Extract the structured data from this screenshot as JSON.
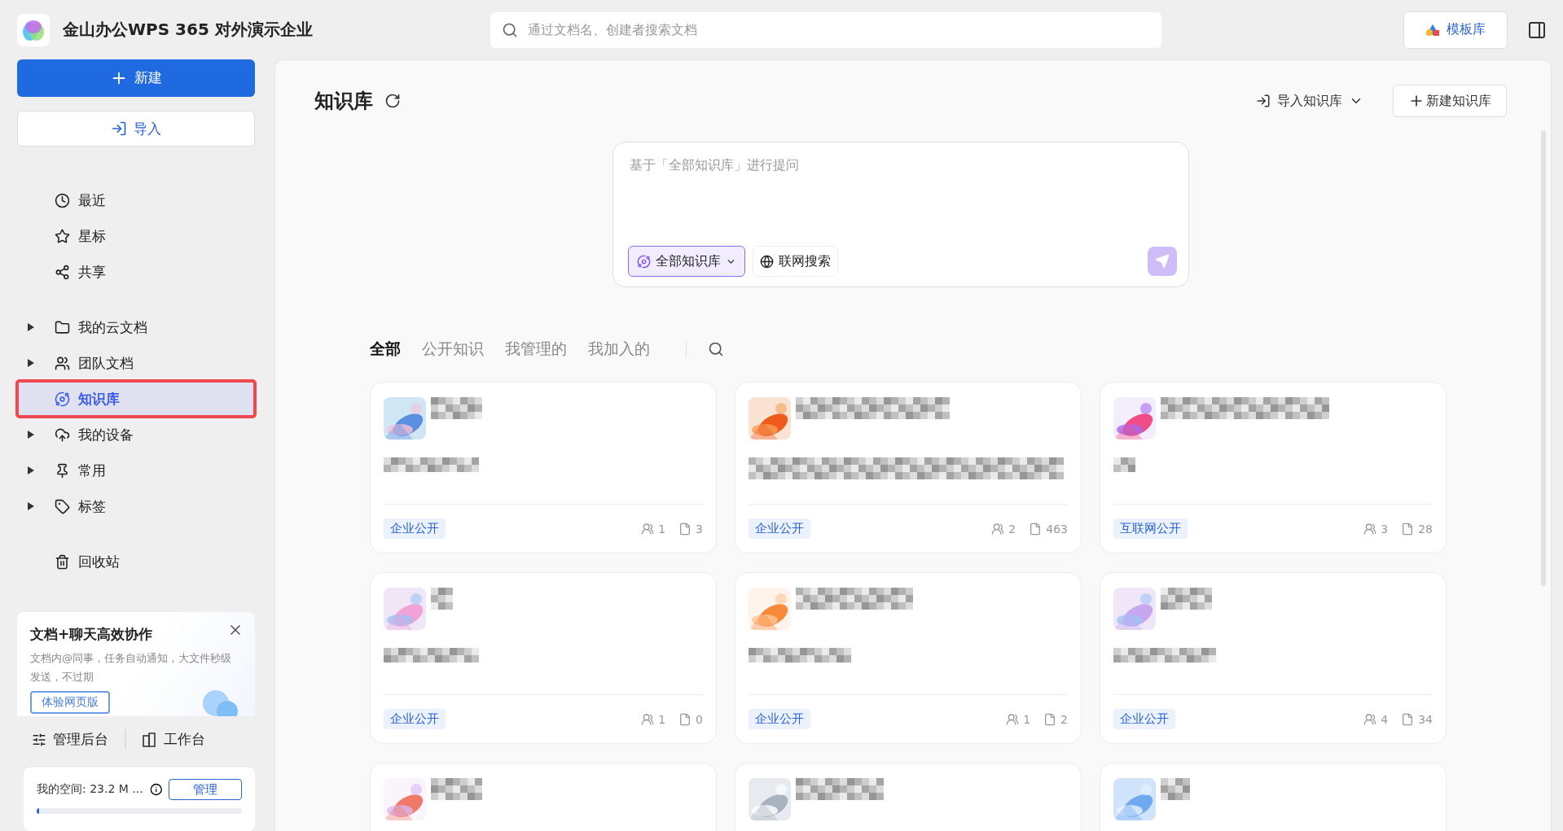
{
  "app": {
    "title": "金山办公WPS 365 对外演示企业"
  },
  "search": {
    "placeholder": "通过文档名、创建者搜索文档"
  },
  "template_button": "模板库",
  "sidebar": {
    "new_button": "新建",
    "import_button": "导入",
    "groups": [
      [
        {
          "label": "最近",
          "selected": false,
          "annotated": false
        },
        {
          "label": "星标",
          "selected": false,
          "annotated": false
        },
        {
          "label": "共享",
          "selected": false,
          "annotated": false
        }
      ],
      [
        {
          "label": "我的云文档",
          "selected": false,
          "annotated": false,
          "expanded": false
        },
        {
          "label": "团队文档",
          "selected": false,
          "annotated": false,
          "expanded": false
        },
        {
          "label": "知识库",
          "selected": true,
          "annotated": true
        },
        {
          "label": "我的设备",
          "selected": false,
          "annotated": false,
          "expanded": false
        },
        {
          "label": "常用",
          "selected": false,
          "annotated": false,
          "expanded": false
        },
        {
          "label": "标签",
          "selected": false,
          "annotated": false,
          "expanded": false
        }
      ],
      [
        {
          "label": "回收站",
          "selected": false,
          "annotated": false
        }
      ]
    ],
    "promo": {
      "title": "文档+聊天高效协作",
      "text": "文档内@同事，任务自动通知，大文件秒级发送，不过期",
      "button": "体验网页版"
    },
    "footer_links": [
      "管理后台",
      "工作台"
    ],
    "storage": {
      "label": "我的空间: 23.2 M ...",
      "button": "管理",
      "level": 0.01
    }
  },
  "main": {
    "title": "知识库",
    "import_menu": "导入知识库",
    "new_button": "新建知识库",
    "ask": {
      "placeholder": "基于「全部知识库」进行提问",
      "scope": "全部知识库",
      "web_search": "联网搜索",
      "send_disabled": true
    },
    "tabs": [
      {
        "label": "全部",
        "selected": true
      },
      {
        "label": "公开知识",
        "selected": false
      },
      {
        "label": "我管理的",
        "selected": false
      },
      {
        "label": "我加入的",
        "selected": false
      }
    ],
    "cards": [
      {
        "thumb": {
          "kind": "picture"
        },
        "tag": "企业公开",
        "members": "1",
        "docs": "3"
      },
      {
        "thumb": {
          "kind": "picture"
        },
        "tag": "企业公开",
        "members": "2",
        "docs": "463"
      },
      {
        "thumb": {
          "kind": "picture"
        },
        "tag": "互联网公开",
        "members": "3",
        "docs": "28"
      },
      {
        "thumb": {
          "kind": "picture"
        },
        "tag": "企业公开",
        "members": "1",
        "docs": "0"
      },
      {
        "thumb": {
          "kind": "picture"
        },
        "tag": "企业公开",
        "members": "1",
        "docs": "2"
      },
      {
        "thumb": {
          "kind": "picture"
        },
        "tag": "企业公开",
        "members": "4",
        "docs": "34"
      },
      {
        "thumb": {
          "kind": "picture"
        }
      },
      {
        "thumb": {
          "kind": "picture"
        }
      },
      {
        "thumb": {
          "kind": "picture"
        }
      }
    ]
  }
}
